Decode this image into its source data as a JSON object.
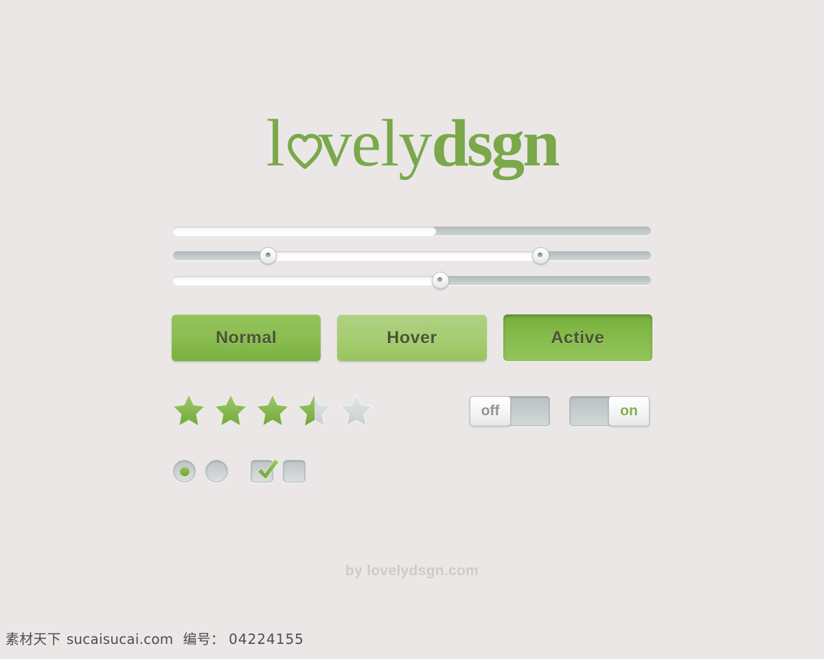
{
  "page": {
    "background_color": "#ebe7e7",
    "accent_green": "#8bbd52",
    "accent_green_dark": "#7aa84b",
    "neutral_gray": "#c3c9ca"
  },
  "logo": {
    "part_light": "l",
    "heart_icon": "heart-icon",
    "part_light_2": "vely",
    "part_bold": "dsgn",
    "full_text": "lovelydsgn",
    "color": "#7aa84b"
  },
  "sliders": [
    {
      "name": "progress-bar",
      "fill_percent": 55,
      "handles": []
    },
    {
      "name": "range-slider",
      "fill_start_percent": 20,
      "fill_end_percent": 77,
      "handles": [
        20,
        77
      ]
    },
    {
      "name": "single-slider",
      "fill_percent": 56,
      "handles": [
        56
      ]
    }
  ],
  "buttons": [
    {
      "label": "Normal",
      "state": "normal",
      "color": "#8bbd52"
    },
    {
      "label": "Hover",
      "state": "hover",
      "color": "#a6cd73"
    },
    {
      "label": "Active",
      "state": "active",
      "color": "#85ba4b"
    }
  ],
  "rating": {
    "value": 3.5,
    "max": 5,
    "filled_color": "#8bbd52",
    "empty_color": "#d3d8d8",
    "stars": [
      "full",
      "full",
      "full",
      "half",
      "empty"
    ]
  },
  "toggles": [
    {
      "label": "off",
      "state": "off",
      "knob_side": "left",
      "label_color": "#8d9395"
    },
    {
      "label": "on",
      "state": "on",
      "knob_side": "right",
      "label_color": "#7fb04b"
    }
  ],
  "choices": [
    {
      "type": "radio",
      "checked": true
    },
    {
      "type": "radio",
      "checked": false
    },
    {
      "type": "checkbox",
      "checked": true
    },
    {
      "type": "checkbox",
      "checked": false
    }
  ],
  "footer": {
    "text": "by lovelydsgn.com"
  },
  "watermark": {
    "site_cn": "素材天下",
    "site_url": "sucaisucai.com",
    "id_label": "编号：",
    "id_value": "04224155"
  }
}
